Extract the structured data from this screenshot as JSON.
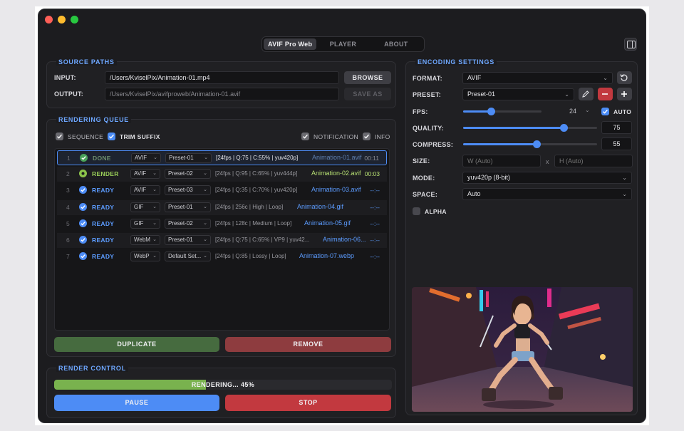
{
  "window": {
    "tabs": [
      {
        "label": "AVIF Pro Web",
        "active": true
      },
      {
        "label": "PLAYER",
        "active": false
      },
      {
        "label": "ABOUT",
        "active": false
      }
    ]
  },
  "source_paths": {
    "title": "SOURCE PATHS",
    "input_label": "INPUT:",
    "input_value": "/Users/KviselPix/Animation-01.mp4",
    "browse_label": "BROWSE",
    "output_label": "OUTPUT:",
    "output_value": "/Users/KviselPix/avifproweb/Animation-01.avif",
    "save_as_label": "SAVE AS"
  },
  "rendering_queue": {
    "title": "RENDERING QUEUE",
    "options": {
      "sequence": {
        "label": "SEQUENCE",
        "checked": true
      },
      "trim_suffix": {
        "label": "TRIM SUFFIX",
        "checked": true
      },
      "notification": {
        "label": "NOTIFICATION",
        "checked": true
      },
      "info": {
        "label": "INFO",
        "checked": true
      }
    },
    "rows": [
      {
        "num": "1",
        "status": "DONE",
        "format": "AVIF",
        "preset": "Preset-01",
        "info": "[24fps | Q:75 | C:55% | yuv420p]",
        "file": "Animation-01.avif",
        "time": "00:11",
        "status_color": "#4aa35a"
      },
      {
        "num": "2",
        "status": "RENDER",
        "format": "AVIF",
        "preset": "Preset-02",
        "info": "[24fps | Q:95 | C:65% | yuv444p]",
        "file": "Animation-02.avif",
        "time": "00:03",
        "status_color": "#8bc34a"
      },
      {
        "num": "3",
        "status": "READY",
        "format": "AVIF",
        "preset": "Preset-03",
        "info": "[24fps | Q:35 | C:70% | yuv420p]",
        "file": "Animation-03.avif",
        "time": "--:--",
        "status_color": "#4d8cf5"
      },
      {
        "num": "4",
        "status": "READY",
        "format": "GIF",
        "preset": "Preset-01",
        "info": "[24fps | 256c | High | Loop]",
        "file": "Animation-04.gif",
        "time": "--:--",
        "status_color": "#4d8cf5"
      },
      {
        "num": "5",
        "status": "READY",
        "format": "GIF",
        "preset": "Preset-02",
        "info": "[24fps | 128c | Medium | Loop]",
        "file": "Animation-05.gif",
        "time": "--:--",
        "status_color": "#4d8cf5"
      },
      {
        "num": "6",
        "status": "READY",
        "format": "WebM",
        "preset": "Preset-01",
        "info": "[24fps | Q:75 | C:65% | VP9 | yuv42...",
        "file": "Animation-06...",
        "time": "--:--",
        "status_color": "#4d8cf5"
      },
      {
        "num": "7",
        "status": "READY",
        "format": "WebP",
        "preset": "Default Set...",
        "info": "[24fps | Q:85 | Lossy | Loop]",
        "file": "Animation-07.webp",
        "time": "--:--",
        "status_color": "#4d8cf5"
      }
    ],
    "duplicate_label": "DUPLICATE",
    "remove_label": "REMOVE"
  },
  "render_control": {
    "title": "RENDER CONTROL",
    "progress_text": "RENDERING... 45%",
    "progress": 0.45,
    "pause_label": "PAUSE",
    "stop_label": "STOP"
  },
  "encoding_settings": {
    "title": "ENCODING SETTINGS",
    "format_label": "FORMAT:",
    "format_value": "AVIF",
    "preset_label": "PRESET:",
    "preset_value": "Preset-01",
    "fps_label": "FPS:",
    "fps_value": "24",
    "fps_level": 0.35,
    "auto_label": "AUTO",
    "auto_checked": true,
    "quality_label": "QUALITY:",
    "quality_value": "75",
    "quality_level": 0.75,
    "compress_label": "COMPRESS:",
    "compress_value": "55",
    "compress_level": 0.55,
    "size_label": "SIZE:",
    "width_placeholder": "W (Auto)",
    "size_separator": "x",
    "height_placeholder": "H (Auto)",
    "mode_label": "MODE:",
    "mode_value": "yuv420p (8-bit)",
    "space_label": "SPACE:",
    "space_value": "Auto",
    "alpha_label": "ALPHA",
    "alpha_checked": false
  },
  "colors": {
    "accent": "#4d8cf5",
    "section_title": "#6ea7ff",
    "duplicate": "#466b3f",
    "remove": "#8e3c3f",
    "pause": "#4d8cf5",
    "stop": "#c2393f",
    "progress": "#79b24e"
  }
}
